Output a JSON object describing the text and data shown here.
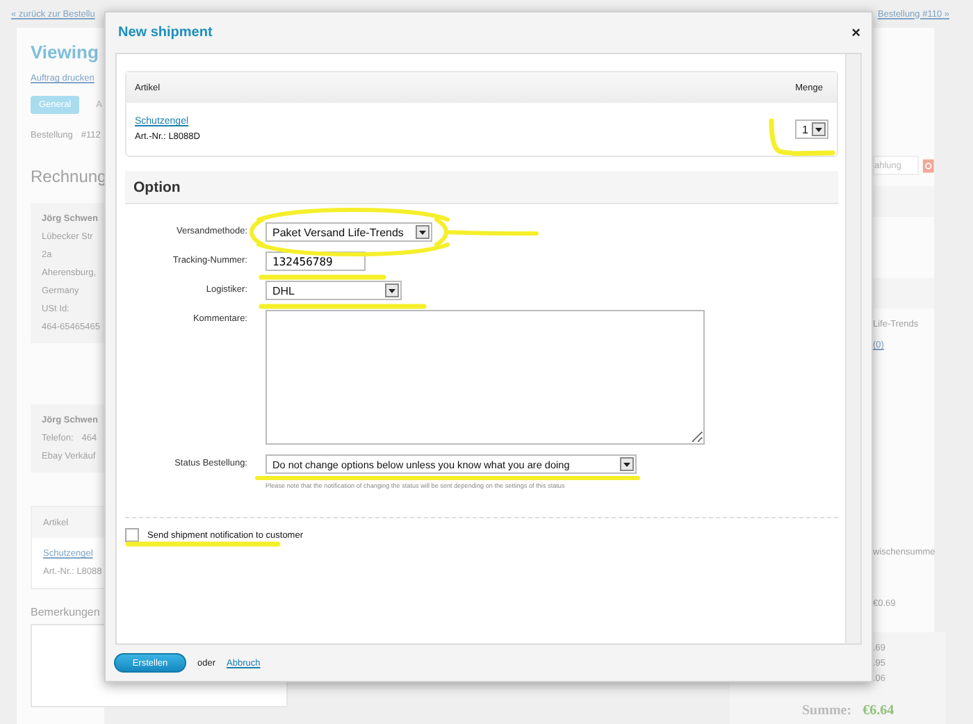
{
  "background": {
    "back_link": "« zurück zur Bestellu",
    "next_link": "Bestellung #110 »",
    "heading": "Viewing",
    "print_link": "Auftrag drucken",
    "tabs": [
      {
        "label": "General",
        "selected": true
      },
      {
        "label": "A",
        "selected": false
      }
    ],
    "order_label": "Bestellung",
    "order_number": "#112",
    "billing_heading": "Rechnung",
    "billing_address": [
      "Jörg Schwen",
      "Lübecker Str",
      "2a",
      "Aherensburg,",
      "Germany",
      "USt Id:",
      "464-65465465"
    ],
    "contact": {
      "name": "Jörg Schwen",
      "phone_label": "Telefon:",
      "phone": "464",
      "seller": "Ebay Verkäuf"
    },
    "articles": {
      "column": "Artikel",
      "item": "Schutzengel",
      "sku": "Art.-Nr.: L8088"
    },
    "remarks_label": "Bemerkungen",
    "payment_field": "ahlung",
    "shipping_method": "Life-Trends",
    "link_count": "(0)",
    "subtotal_column": "wischensumme",
    "subtotal": "€0.69",
    "totals": [
      ".69",
      ".95",
      ".06"
    ],
    "sum_label": "Summe:",
    "sum": "€6.64"
  },
  "dialog": {
    "title": "New shipment",
    "close": "×",
    "items_table": {
      "columns": [
        "Artikel",
        "Menge"
      ],
      "rows": [
        {
          "name": "Schutzengel",
          "sku": "Art.-Nr.: L8088D",
          "quantity": "1"
        }
      ]
    },
    "section": "Option",
    "fields": [
      {
        "kind": "select",
        "label": "Versandmethode:",
        "value": "Paket Versand Life-Trends"
      },
      {
        "kind": "text",
        "label": "Tracking-Nummer:",
        "value": "132456789"
      },
      {
        "kind": "select",
        "label": "Logistiker:",
        "value": "DHL"
      },
      {
        "kind": "textarea",
        "label": "Kommentare:"
      },
      {
        "kind": "select",
        "label": "Status Bestellung:",
        "value": "Do not change options below unless you know what you are doing",
        "note": "Please note that the notification of changing the status will be sent depending on the settings of this status"
      }
    ],
    "notify": {
      "label": "Send shipment notification to customer",
      "checked": false
    },
    "footer": {
      "submit": "Erstellen",
      "or": "oder",
      "cancel": "Abbruch"
    }
  }
}
